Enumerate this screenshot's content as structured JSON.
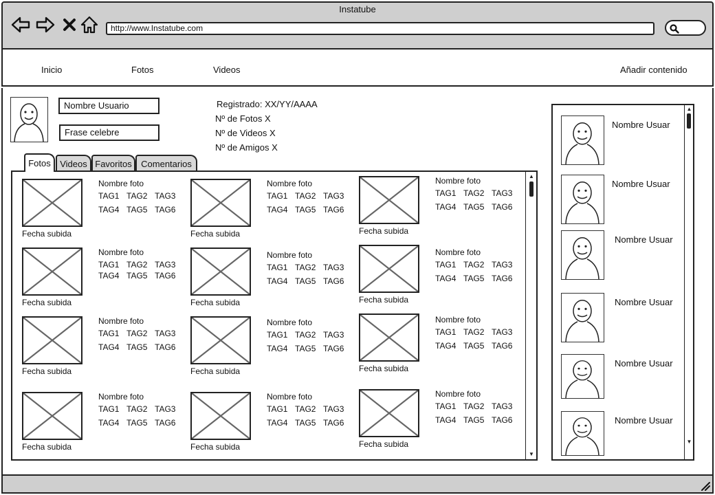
{
  "window": {
    "title": "Instatube"
  },
  "toolbar": {
    "url": "http://www.Instatube.com"
  },
  "nav": {
    "items": [
      "Inicio",
      "Fotos",
      "Videos"
    ],
    "add_content": "Añadir contenido"
  },
  "profile": {
    "username": "Nombre Usuario",
    "quote": "Frase celebre",
    "registered": "Registrado: XX/YY/AAAA",
    "photos_count": "Nº de Fotos X",
    "videos_count": "Nº de Videos X",
    "friends_count": "Nº de Amigos X"
  },
  "tabs": [
    "Fotos",
    "Videos",
    "Favoritos",
    "Comentarios"
  ],
  "active_tab": "Fotos",
  "photo_labels": {
    "name": "Nombre foto",
    "date": "Fecha subida",
    "tags": [
      "TAG1",
      "TAG2",
      "TAG3",
      "TAG4",
      "TAG5",
      "TAG6"
    ]
  },
  "photo_grid": {
    "rows": 4,
    "columns": 3
  },
  "friends": [
    "Nombre Usuar",
    "Nombre Usuar",
    "Nombre Usuar",
    "Nombre Usuar",
    "Nombre Usuar",
    "Nombre Usuar"
  ],
  "colors": {
    "chrome": "#cfcfcf",
    "stroke": "#222222",
    "tab_inactive": "#d8d8d8"
  }
}
